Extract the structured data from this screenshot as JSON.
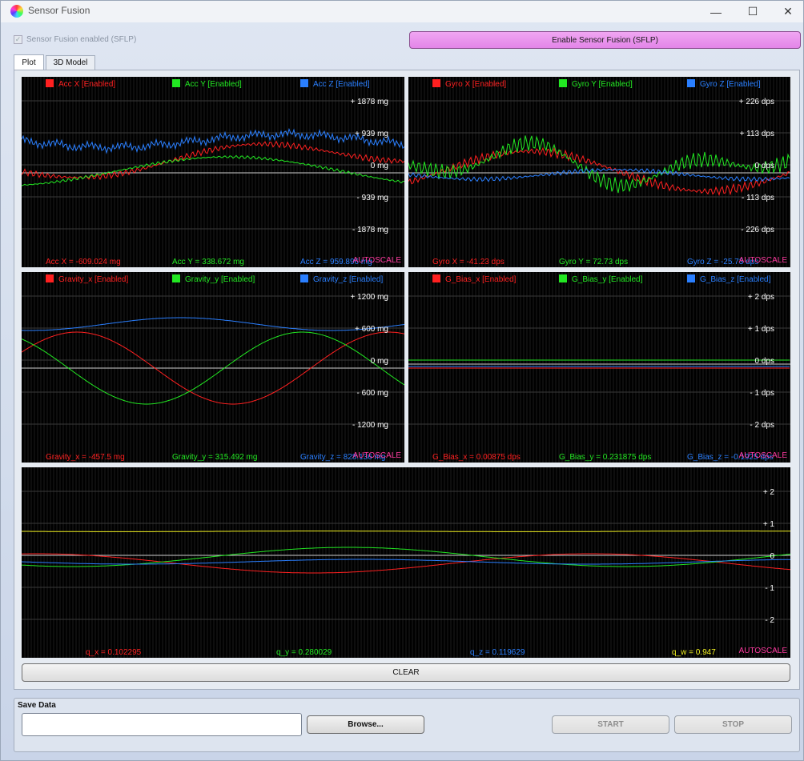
{
  "window": {
    "title": "Sensor Fusion",
    "controls": {
      "minimize": "—",
      "maximize": "☐",
      "close": "✕"
    }
  },
  "sensor_fusion": {
    "checkbox_label": "Sensor Fusion enabled (SFLP)",
    "checked": true,
    "enable_button": "Enable Sensor Fusion (SFLP)"
  },
  "tabs": [
    {
      "label": "Plot",
      "active": true
    },
    {
      "label": "3D Model",
      "active": false
    }
  ],
  "plots": [
    {
      "id": "acc",
      "legend": [
        "Acc X [Enabled]",
        "Acc Y [Enabled]",
        "Acc Z [Enabled]"
      ],
      "y_ticks": [
        "+ 1878 mg",
        "+ 939 mg",
        "0 mg",
        "- 939 mg",
        "- 1878 mg"
      ],
      "readouts": [
        "Acc X = -609.024 mg",
        "Acc Y = 338.672 mg",
        "Acc Z = 959.896 mg"
      ],
      "autoscale": "AUTOSCALE"
    },
    {
      "id": "gyro",
      "legend": [
        "Gyro X [Enabled]",
        "Gyro Y [Enabled]",
        "Gyro Z [Enabled]"
      ],
      "y_ticks": [
        "+ 226 dps",
        "+ 113 dps",
        "0 dps",
        "- 113 dps",
        "- 226 dps"
      ],
      "readouts": [
        "Gyro X = -41.23 dps",
        "Gyro Y = 72.73 dps",
        "Gyro Z = -25.73 dps"
      ],
      "autoscale": "AUTOSCALE"
    },
    {
      "id": "gravity",
      "legend": [
        "Gravity_x [Enabled]",
        "Gravity_y [Enabled]",
        "Gravity_z [Enabled]"
      ],
      "y_ticks": [
        "+ 1200 mg",
        "+ 600 mg",
        "0 mg",
        "- 600 mg",
        "- 1200 mg"
      ],
      "readouts": [
        "Gravity_x = -457.5 mg",
        "Gravity_y = 315.492 mg",
        "Gravity_z = 828.136 mg"
      ],
      "autoscale": "AUTOSCALE"
    },
    {
      "id": "gbias",
      "legend": [
        "G_Bias_x [Enabled]",
        "G_Bias_y [Enabled]",
        "G_Bias_z [Enabled]"
      ],
      "y_ticks": [
        "+ 2 dps",
        "+ 1 dps",
        "0 dps",
        "- 1 dps",
        "- 2 dps"
      ],
      "readouts": [
        "G_Bias_x = 0.00875 dps",
        "G_Bias_y = 0.231875 dps",
        "G_Bias_z = -0.1925 dps"
      ],
      "autoscale": "AUTOSCALE"
    },
    {
      "id": "quat",
      "legend": [],
      "y_ticks": [
        "+ 2",
        "+ 1",
        "0",
        "- 1",
        "- 2"
      ],
      "readouts": [
        "q_x = 0.102295",
        "q_y = 0.280029",
        "q_z = 0.119629",
        "q_w = 0.947"
      ],
      "autoscale": "AUTOSCALE"
    }
  ],
  "colors": {
    "x": "#ff2020",
    "y": "#22e822",
    "z": "#2a7fff",
    "w": "#f0f020",
    "autoscale": "#ff3aa0",
    "enable_button": "#e385e8"
  },
  "clear_button": "CLEAR",
  "save_data": {
    "title": "Save Data",
    "path_value": "",
    "browse_button": "Browse...",
    "start_button": "START",
    "stop_button": "STOP"
  }
}
